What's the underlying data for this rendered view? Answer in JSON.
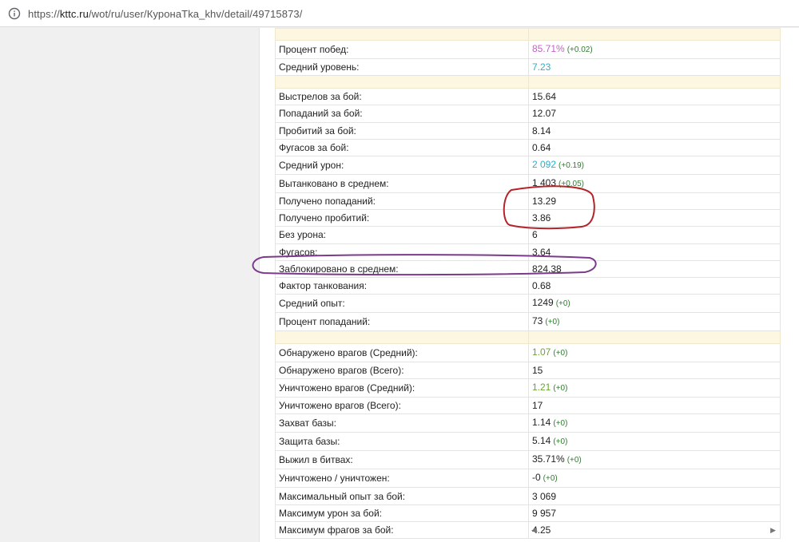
{
  "browser": {
    "url_prefix": "https://",
    "url_host": "kttc.ru",
    "url_path": "/wot/ru/user/КуронаТka_khv/detail/49715873/"
  },
  "stats": {
    "group1": [
      {
        "label": "Процент побед:",
        "value": "85.71%",
        "delta": "(+0.02)",
        "color": "pink"
      },
      {
        "label": "Средний уровень:",
        "value": "7.23",
        "delta": "",
        "color": "teal"
      }
    ],
    "group2": [
      {
        "label": "Выстрелов за бой:",
        "value": "15.64",
        "delta": "",
        "color": ""
      },
      {
        "label": "Попаданий за бой:",
        "value": "12.07",
        "delta": "",
        "color": ""
      },
      {
        "label": "Пробитий за бой:",
        "value": "8.14",
        "delta": "",
        "color": ""
      },
      {
        "label": "Фугасов за бой:",
        "value": "0.64",
        "delta": "",
        "color": ""
      },
      {
        "label": "Средний урон:",
        "value": "2 092",
        "delta": "(+0.19)",
        "color": "teal"
      },
      {
        "label": "Вытанковано в среднем:",
        "value": "1 403",
        "delta": "(+0.05)",
        "color": ""
      },
      {
        "label": "Получено попаданий:",
        "value": "13.29",
        "delta": "",
        "color": ""
      },
      {
        "label": "Получено пробитий:",
        "value": "3.86",
        "delta": "",
        "color": ""
      },
      {
        "label": "Без урона:",
        "value": "6",
        "delta": "",
        "color": ""
      },
      {
        "label": "Фугасов:",
        "value": "3.64",
        "delta": "",
        "color": ""
      },
      {
        "label": "Заблокировано в среднем:",
        "value": "824.38",
        "delta": "",
        "color": ""
      },
      {
        "label": "Фактор танкования:",
        "value": "0.68",
        "delta": "",
        "color": ""
      },
      {
        "label": "Средний опыт:",
        "value": "1249",
        "delta": "(+0)",
        "color": ""
      },
      {
        "label": "Процент попаданий:",
        "value": "73",
        "delta": "(+0)",
        "color": ""
      }
    ],
    "group3": [
      {
        "label": "Обнаружено врагов (Средний):",
        "value": "1.07",
        "delta": "(+0)",
        "color": "green"
      },
      {
        "label": "Обнаружено врагов (Всего):",
        "value": "15",
        "delta": "",
        "color": ""
      },
      {
        "label": "Уничтожено врагов (Средний):",
        "value": "1.21",
        "delta": "(+0)",
        "color": "green"
      },
      {
        "label": "Уничтожено врагов (Всего):",
        "value": "17",
        "delta": "",
        "color": ""
      },
      {
        "label": "Захват базы:",
        "value": "1.14",
        "delta": "(+0)",
        "color": ""
      },
      {
        "label": "Защита базы:",
        "value": "5.14",
        "delta": "(+0)",
        "color": ""
      },
      {
        "label": "Выжил в битвах:",
        "value": "35.71%",
        "delta": "(+0)",
        "color": ""
      },
      {
        "label": "Уничтожено / уничтожен:",
        "value": "-0",
        "delta": "(+0)",
        "color": ""
      },
      {
        "label": "Максимальный опыт за бой:",
        "value": "3 069",
        "delta": "",
        "color": ""
      },
      {
        "label": "Максимум урон за бой:",
        "value": "9 957",
        "delta": "",
        "color": ""
      },
      {
        "label": "Максимум фрагов за бой:",
        "value": "4.25",
        "delta": "",
        "color": ""
      }
    ]
  },
  "colors": {
    "pink": "#c35fc6",
    "teal": "#2ab0cc",
    "green": "#6aa531",
    "delta": "#2e7d2e",
    "separator": "#fdf7e1",
    "annotation_red": "#b5232a",
    "annotation_purple": "#7d3a8c"
  },
  "scrollbar": {
    "left_arrow": "◀",
    "right_arrow": "▶"
  }
}
